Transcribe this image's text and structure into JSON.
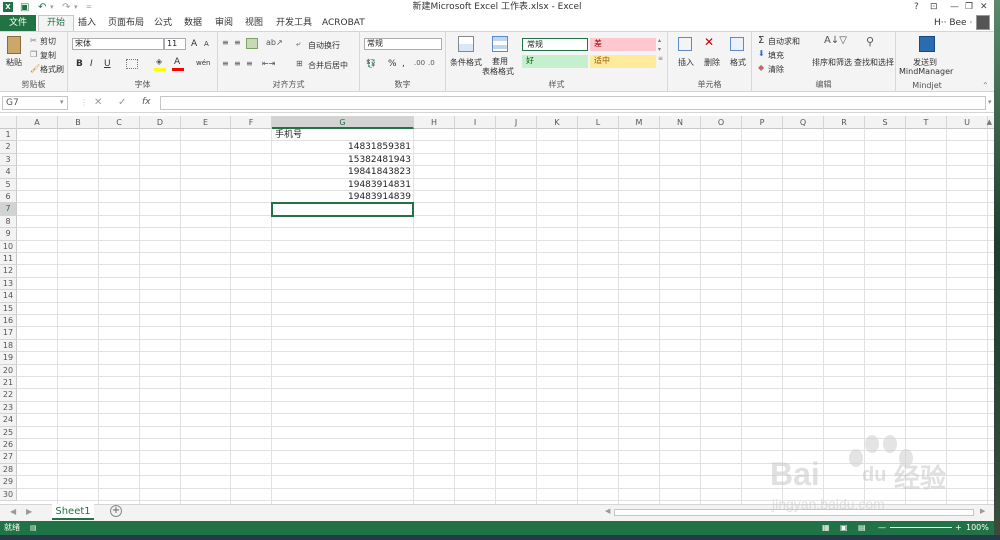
{
  "window": {
    "title": "新建Microsoft Excel 工作表.xlsx - Excel",
    "help": "?",
    "user": "H·· Bee ·"
  },
  "tabs": {
    "file": "文件",
    "items": [
      "开始",
      "插入",
      "页面布局",
      "公式",
      "数据",
      "审阅",
      "视图",
      "开发工具",
      "ACROBAT"
    ],
    "active_index": 0
  },
  "ribbon": {
    "clipboard": {
      "paste": "粘贴",
      "cut": "剪切",
      "copy": "复制",
      "format_painter": "格式刷",
      "label": "剪贴板"
    },
    "font": {
      "name": "宋体",
      "size": "11",
      "bold": "B",
      "italic": "I",
      "underline": "U",
      "label": "字体",
      "grow": "A",
      "shrink": "A",
      "color_a": "A",
      "phonetic": "wén"
    },
    "alignment": {
      "wrap": "自动换行",
      "merge": "合并后居中",
      "label": "对齐方式"
    },
    "number": {
      "format": "常规",
      "percent": "%",
      "comma": ",",
      "label": "数字"
    },
    "styles": {
      "conditional": "条件格式",
      "table_line1": "套用",
      "table_line2": "表格格式",
      "normal": "常规",
      "bad": "差",
      "good": "好",
      "neutral": "适中",
      "label": "样式",
      "colors": {
        "normal_bg": "#ffffff",
        "bad_bg": "#ffc7ce",
        "bad_fg": "#9c0006",
        "good_bg": "#c6efce",
        "good_fg": "#006100",
        "neutral_bg": "#ffeb9c",
        "neutral_fg": "#9c5700"
      }
    },
    "cells": {
      "insert": "插入",
      "delete": "删除",
      "format": "格式",
      "label": "单元格"
    },
    "editing": {
      "autosum": "自动求和",
      "fill": "填充",
      "clear": "清除",
      "sort": "排序和筛选",
      "find": "查找和选择",
      "label": "编辑"
    },
    "mindjet": {
      "line1": "发送到",
      "line2": "MindManager",
      "label": "Mindjet"
    }
  },
  "formula_bar": {
    "name_box": "G7",
    "cancel": "✕",
    "enter": "✓",
    "fx": "fx",
    "value": ""
  },
  "sheet": {
    "columns": [
      "A",
      "B",
      "C",
      "D",
      "E",
      "F",
      "G",
      "H",
      "I",
      "J",
      "K",
      "L",
      "M",
      "N",
      "O",
      "P",
      "Q",
      "R",
      "S",
      "T",
      "U"
    ],
    "selected_column": "G",
    "selected_row": "7",
    "rows": [
      "1",
      "2",
      "3",
      "4",
      "5",
      "6",
      "7",
      "8",
      "9",
      "10",
      "11",
      "12",
      "13",
      "14",
      "15",
      "16",
      "17",
      "18",
      "19",
      "20",
      "21",
      "22",
      "23",
      "24",
      "25",
      "26",
      "27",
      "28",
      "29",
      "30"
    ],
    "g_header": "手机号",
    "g_values": [
      "14831859381",
      "15382481943",
      "19841843823",
      "19483914831",
      "19483914839"
    ]
  },
  "sheet_tabs": {
    "name": "Sheet1",
    "add": "+"
  },
  "status": {
    "ready": "就绪",
    "zoom": "100%"
  },
  "accent": "#217346",
  "watermark": {
    "brand": "Bai",
    "brand_cn": "经验",
    "paw": "du",
    "url": "jingyan.baidu.com"
  }
}
